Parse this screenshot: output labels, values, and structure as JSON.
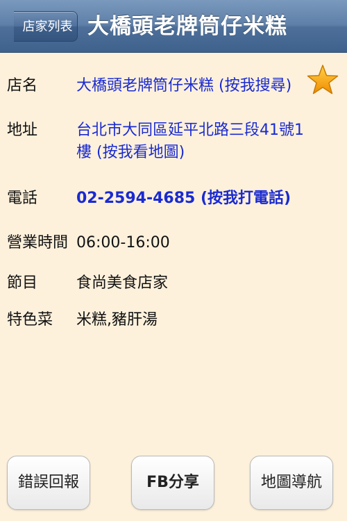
{
  "nav": {
    "back_label": "店家列表",
    "title": "大橋頭老牌筒仔米糕"
  },
  "details": {
    "name_label": "店名",
    "name_value": "大橋頭老牌筒仔米糕 (按我搜尋)",
    "address_label": "地址",
    "address_value": "台北市大同區延平北路三段41號1樓 (按我看地圖)",
    "phone_label": "電話",
    "phone_value": "02-2594-4685 (按我打電話)",
    "hours_label": "營業時間",
    "hours_value": "06:00-16:00",
    "program_label": "節目",
    "program_value": "食尚美食店家",
    "specialty_label": "特色菜",
    "specialty_value": "米糕,豬肝湯"
  },
  "favorite_icon": "star-icon",
  "buttons": {
    "report": "錯誤回報",
    "share": "FB分享",
    "navigate": "地圖導航"
  },
  "colors": {
    "background": "#fdf1dc",
    "navbar": "#5e7fa8",
    "link": "#1a2ad1",
    "star": "#f5a000"
  }
}
